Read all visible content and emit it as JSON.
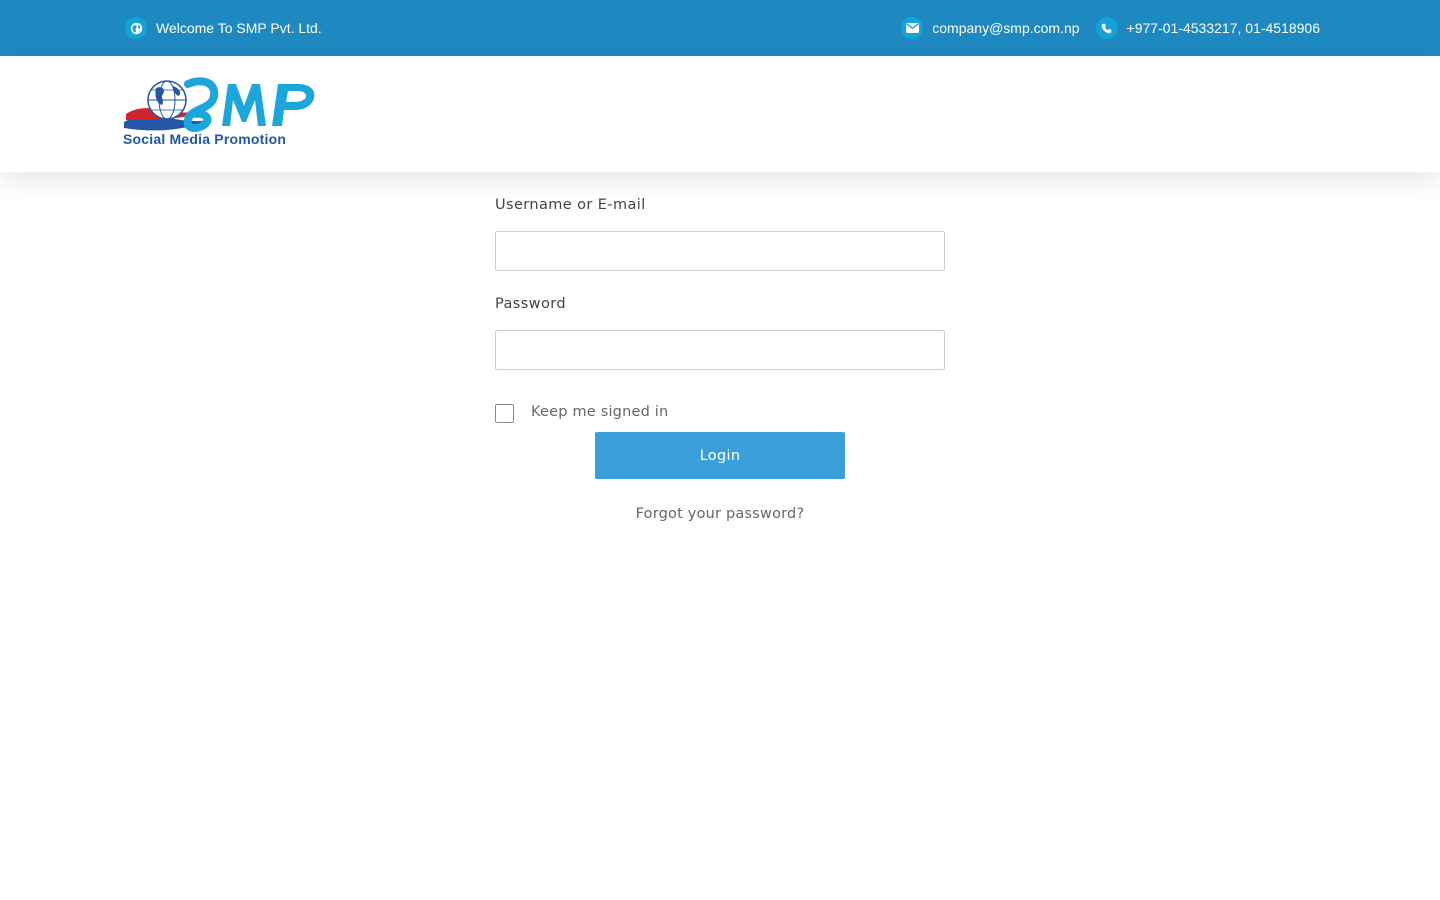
{
  "topbar": {
    "welcome_text": "Welcome To SMP Pvt. Ltd.",
    "email": "company@smp.com.np",
    "phone": "+977-01-4533217, 01-4518906",
    "background_color": "#1e88c0",
    "icon_circle_color": "#11a4da",
    "icons": {
      "welcome": "globe-icon",
      "email": "envelope-icon",
      "phone": "phone-icon"
    }
  },
  "header": {
    "logo": {
      "letters": "SMP",
      "caption": "Social Media Promotion",
      "colors": {
        "letters": "#1ca7dc",
        "caption": "#2356a6",
        "swoosh_red": "#d3232c",
        "swoosh_blue": "#2356a6"
      }
    }
  },
  "login_form": {
    "username_label": "Username or E-mail",
    "username_value": "",
    "password_label": "Password",
    "password_value": "",
    "remember_label": "Keep me signed in",
    "remember_checked": false,
    "submit_label": "Login",
    "forgot_link": "Forgot your password?",
    "button_color": "#3aa0d9"
  }
}
